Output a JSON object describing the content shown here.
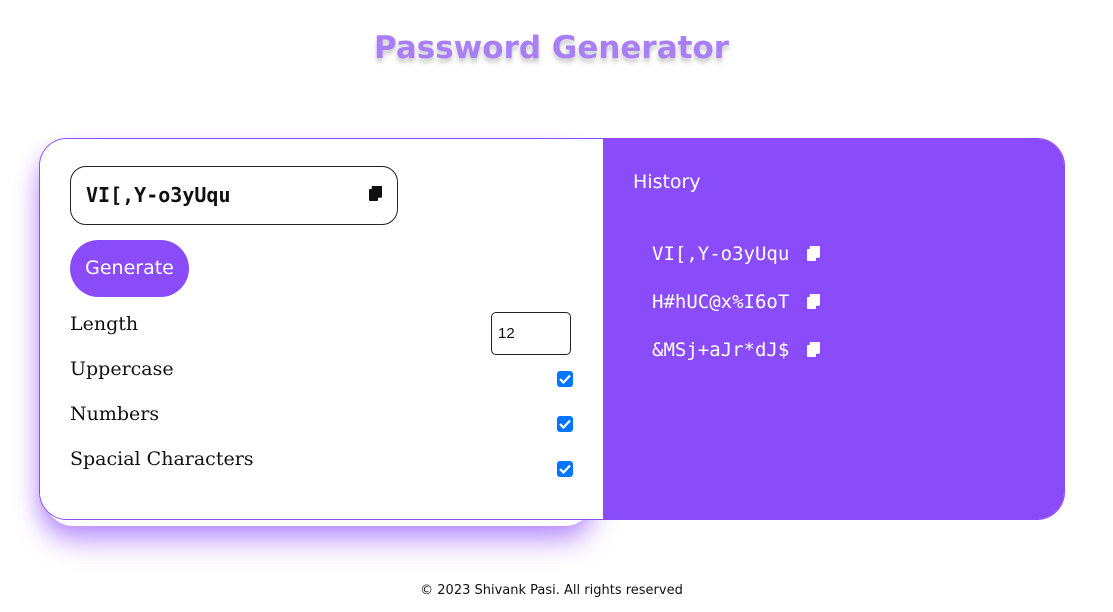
{
  "app": {
    "title": "Password Generator"
  },
  "generator": {
    "password": "VI[,Y-o3yUqu",
    "generate_label": "Generate",
    "options": {
      "length_label": "Length",
      "length_value": "12",
      "uppercase_label": "Uppercase",
      "uppercase_checked": true,
      "numbers_label": "Numbers",
      "numbers_checked": true,
      "special_label": "Spacial Characters",
      "special_checked": true
    }
  },
  "history": {
    "title": "History",
    "items": [
      {
        "password": "VI[,Y-o3yUqu"
      },
      {
        "password": "H#hUC@x%I6oT"
      },
      {
        "password": "&MSj+aJr*dJ$"
      }
    ]
  },
  "footer": {
    "text": "© 2023 Shivank Pasi. All rights reserved"
  },
  "colors": {
    "accent": "#8a4bf8",
    "title": "#a87ff6",
    "checkbox": "#0075ff"
  },
  "icons": {
    "copy": "copy-icon",
    "check": "check-icon"
  }
}
